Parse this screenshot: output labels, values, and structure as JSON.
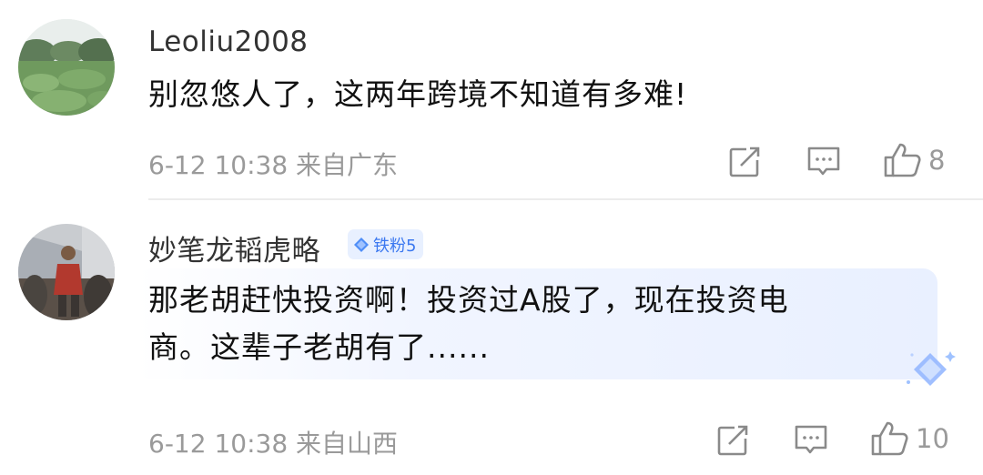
{
  "comments": [
    {
      "username": "Leoliu2008",
      "content": "别忽悠人了，这两年跨境不知道有多难!",
      "meta": "6-12 10:38 来自广东",
      "likes": "8"
    },
    {
      "username": "妙笔龙韬虎略",
      "badge": "铁粉5",
      "content_line1": "那老胡赶快投资啊！投资过A股了，现在投资电",
      "content_line2": "商。这辈子老胡有了......",
      "meta": "6-12 10:38 来自山西",
      "likes": "10"
    }
  ],
  "icons": {
    "share": "share-icon",
    "reply": "comment-icon",
    "like": "thumbs-up-icon",
    "badge": "diamond-icon",
    "decoration": "sparkle-diamond-icon"
  },
  "colors": {
    "text_primary": "#111111",
    "text_secondary": "#9a9a9a",
    "badge_blue": "#3b78f0",
    "highlight": "#e9f0ff"
  }
}
